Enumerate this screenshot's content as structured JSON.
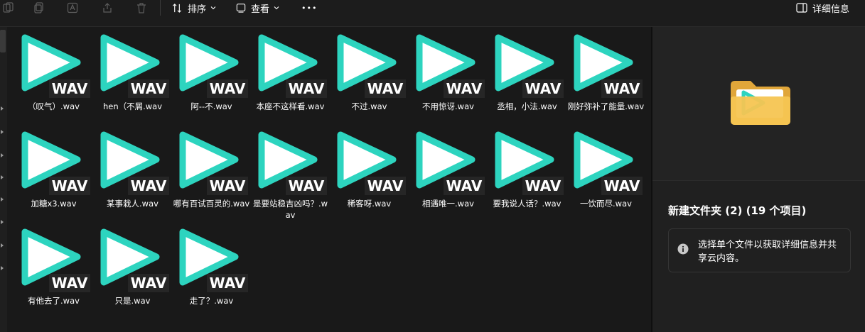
{
  "toolbar": {
    "sort_label": "排序",
    "view_label": "查看",
    "more_label": "•••",
    "details_label": "详细信息"
  },
  "files": [
    {
      "name": "（叹气）.wav"
    },
    {
      "name": "hen（不屑.wav"
    },
    {
      "name": "阿--不.wav"
    },
    {
      "name": "本座不这样看.wav"
    },
    {
      "name": "不过.wav"
    },
    {
      "name": "不用惊讶.wav"
    },
    {
      "name": "丞相，小法.wav"
    },
    {
      "name": "刚好弥补了能量.wav"
    },
    {
      "name": "加糖x3.wav"
    },
    {
      "name": "某事栽人.wav"
    },
    {
      "name": "哪有百试百灵的.wav"
    },
    {
      "name": "是要站稳吉凶吗？.wav"
    },
    {
      "name": "稀客呀.wav"
    },
    {
      "name": "相遇唯一.wav"
    },
    {
      "name": "要我说人话？.wav"
    },
    {
      "name": "一饮而尽.wav"
    },
    {
      "name": "有他去了.wav"
    },
    {
      "name": "只是.wav"
    },
    {
      "name": "走了？.wav"
    }
  ],
  "file_badge": "WAV",
  "details": {
    "title": "新建文件夹 (2) (19 个项目)",
    "info_text": "选择单个文件以获取详细信息并共享云内容。"
  },
  "colors": {
    "accent_teal": "#2dd4bf",
    "background": "#191919",
    "panel": "#202020"
  },
  "icons": {
    "file_icon": "wav-play-icon",
    "folder": "folder-icon",
    "info": "info-icon"
  }
}
